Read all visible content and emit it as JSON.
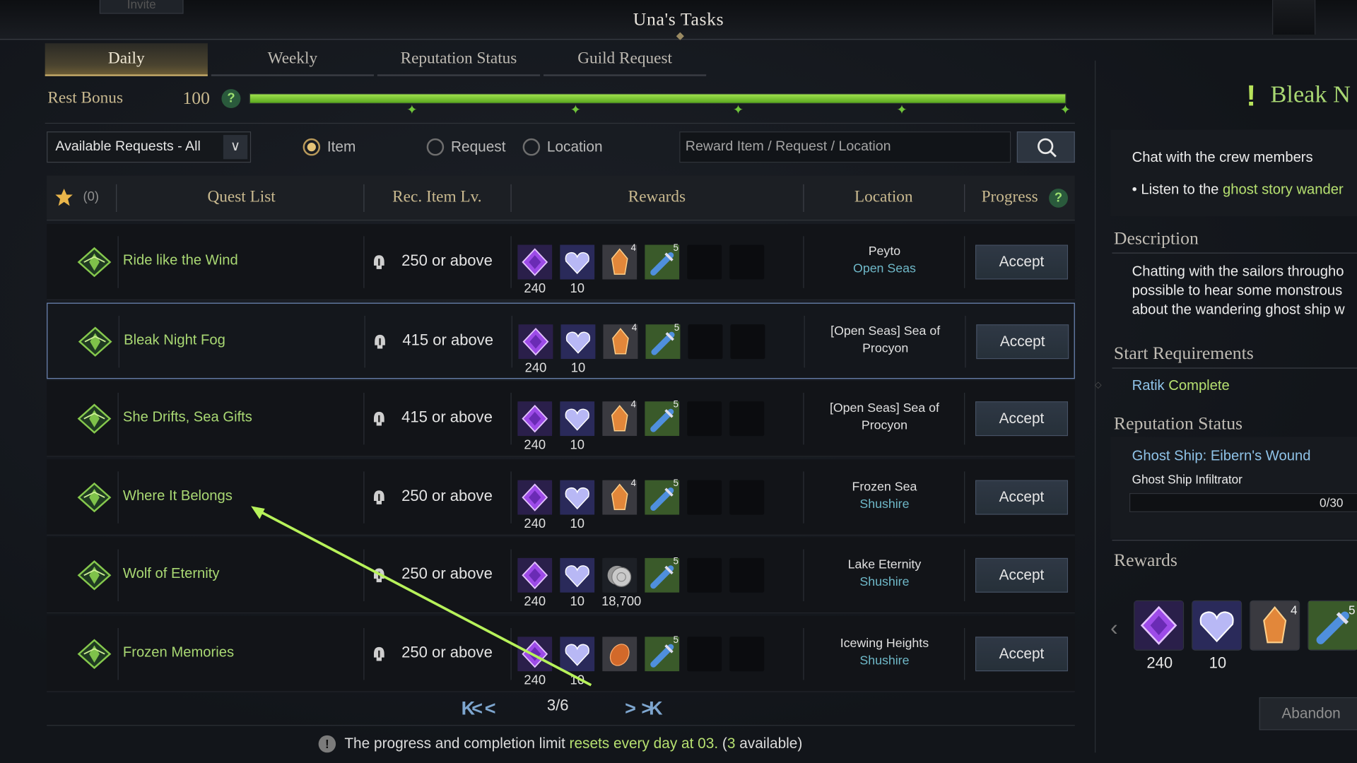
{
  "window": {
    "title": "Una's Tasks",
    "invite_label": "Invite"
  },
  "tabs": [
    {
      "label": "Daily",
      "active": true
    },
    {
      "label": "Weekly",
      "active": false
    },
    {
      "label": "Reputation Status",
      "active": false
    },
    {
      "label": "Guild Request",
      "active": false
    }
  ],
  "rest_bonus": {
    "label": "Rest Bonus",
    "value": "100",
    "help": "?",
    "fill_fraction": 1.0
  },
  "filters": {
    "select_value": "Available Requests - All",
    "radios": [
      {
        "label": "Item",
        "checked": true
      },
      {
        "label": "Request",
        "checked": false
      },
      {
        "label": "Location",
        "checked": false
      }
    ],
    "search_placeholder": "Reward Item / Request / Location"
  },
  "table": {
    "fav_count": "(0)",
    "headers": {
      "quest": "Quest List",
      "level": "Rec. Item Lv.",
      "rewards": "Rewards",
      "location": "Location",
      "progress": "Progress"
    },
    "rows": [
      {
        "name": "Ride like the Wind",
        "level": "250 or above",
        "r1": "240",
        "r2": "10",
        "r3": "",
        "loc1": "Peyto",
        "loc2": "Open Seas",
        "accept": "Accept"
      },
      {
        "name": "Bleak Night Fog",
        "level": "415 or above",
        "r1": "240",
        "r2": "10",
        "r3": "",
        "loc1": "[Open Seas] Sea of",
        "loc2": "Procyon",
        "accept": "Accept"
      },
      {
        "name": "She Drifts, Sea Gifts",
        "level": "415 or above",
        "r1": "240",
        "r2": "10",
        "r3": "",
        "loc1": "[Open Seas] Sea of",
        "loc2": "Procyon",
        "accept": "Accept"
      },
      {
        "name": "Where It Belongs",
        "level": "250 or above",
        "r1": "240",
        "r2": "10",
        "r3": "",
        "loc1": "Frozen Sea",
        "loc2": "Shushire",
        "accept": "Accept"
      },
      {
        "name": "Wolf of Eternity",
        "level": "250 or above",
        "r1": "240",
        "r2": "10",
        "r3": "18,700",
        "loc1": "Lake Eternity",
        "loc2": "Shushire",
        "accept": "Accept"
      },
      {
        "name": "Frozen Memories",
        "level": "250 or above",
        "r1": "240",
        "r2": "10",
        "r3": "",
        "loc1": "Icewing Heights",
        "loc2": "Shushire",
        "accept": "Accept"
      }
    ],
    "badge_4": "4",
    "badge_5": "5"
  },
  "pager": {
    "text": "3/6",
    "first": "K<",
    "prev": "<",
    "next": ">",
    "last": ">K"
  },
  "notice": {
    "pre": "The progress and completion limit ",
    "hl": "resets every day at 03.",
    "mid": " (",
    "count": "3",
    "post": " available)"
  },
  "detail": {
    "title": "Bleak N",
    "objective": "Chat with the crew members",
    "bullet_pre": "Listen to the ",
    "bullet_hl": "ghost story wander",
    "desc_head": "Description",
    "desc_lines": [
      "Chatting with the sailors througho",
      "possible to hear some monstrous",
      "about the wandering ghost ship w"
    ],
    "req_head": "Start Requirements",
    "req_name": "Ratik",
    "req_status": "Complete",
    "rep_head": "Reputation Status",
    "rep_name": "Ghost Ship: Eibern's Wound",
    "rep_rank": "Ghost Ship Infiltrator",
    "rep_progress": "0/30",
    "rewards_head": "Rewards",
    "reward_values": [
      "240",
      "10"
    ],
    "badge_4": "4",
    "badge_5": "5",
    "abandon": "Abandon"
  },
  "colors": {
    "accent_green": "#a9d873",
    "gold": "#c9b98f",
    "bar_green": "#8fd33e"
  }
}
